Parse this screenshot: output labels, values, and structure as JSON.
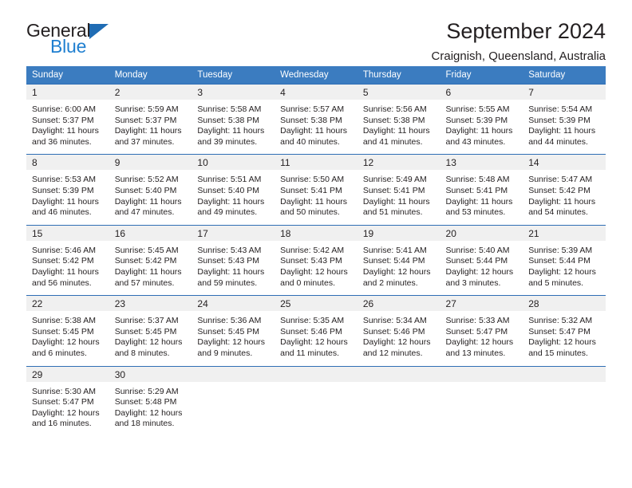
{
  "brand": {
    "name_top": "General",
    "name_bottom": "Blue",
    "accent_color": "#1f7fd0",
    "triangle_color": "#1f6cb4"
  },
  "header": {
    "title": "September 2024",
    "subtitle": "Craignish, Queensland, Australia"
  },
  "calendar": {
    "header_bg": "#3b7cc0",
    "header_text_color": "#ffffff",
    "daynum_bg": "#f0f0f0",
    "row_border_color": "#2f6eb5",
    "weekday_headers": [
      "Sunday",
      "Monday",
      "Tuesday",
      "Wednesday",
      "Thursday",
      "Friday",
      "Saturday"
    ],
    "weeks": [
      [
        {
          "day": "1",
          "sunrise": "Sunrise: 6:00 AM",
          "sunset": "Sunset: 5:37 PM",
          "daylight_1": "Daylight: 11 hours",
          "daylight_2": "and 36 minutes."
        },
        {
          "day": "2",
          "sunrise": "Sunrise: 5:59 AM",
          "sunset": "Sunset: 5:37 PM",
          "daylight_1": "Daylight: 11 hours",
          "daylight_2": "and 37 minutes."
        },
        {
          "day": "3",
          "sunrise": "Sunrise: 5:58 AM",
          "sunset": "Sunset: 5:38 PM",
          "daylight_1": "Daylight: 11 hours",
          "daylight_2": "and 39 minutes."
        },
        {
          "day": "4",
          "sunrise": "Sunrise: 5:57 AM",
          "sunset": "Sunset: 5:38 PM",
          "daylight_1": "Daylight: 11 hours",
          "daylight_2": "and 40 minutes."
        },
        {
          "day": "5",
          "sunrise": "Sunrise: 5:56 AM",
          "sunset": "Sunset: 5:38 PM",
          "daylight_1": "Daylight: 11 hours",
          "daylight_2": "and 41 minutes."
        },
        {
          "day": "6",
          "sunrise": "Sunrise: 5:55 AM",
          "sunset": "Sunset: 5:39 PM",
          "daylight_1": "Daylight: 11 hours",
          "daylight_2": "and 43 minutes."
        },
        {
          "day": "7",
          "sunrise": "Sunrise: 5:54 AM",
          "sunset": "Sunset: 5:39 PM",
          "daylight_1": "Daylight: 11 hours",
          "daylight_2": "and 44 minutes."
        }
      ],
      [
        {
          "day": "8",
          "sunrise": "Sunrise: 5:53 AM",
          "sunset": "Sunset: 5:39 PM",
          "daylight_1": "Daylight: 11 hours",
          "daylight_2": "and 46 minutes."
        },
        {
          "day": "9",
          "sunrise": "Sunrise: 5:52 AM",
          "sunset": "Sunset: 5:40 PM",
          "daylight_1": "Daylight: 11 hours",
          "daylight_2": "and 47 minutes."
        },
        {
          "day": "10",
          "sunrise": "Sunrise: 5:51 AM",
          "sunset": "Sunset: 5:40 PM",
          "daylight_1": "Daylight: 11 hours",
          "daylight_2": "and 49 minutes."
        },
        {
          "day": "11",
          "sunrise": "Sunrise: 5:50 AM",
          "sunset": "Sunset: 5:41 PM",
          "daylight_1": "Daylight: 11 hours",
          "daylight_2": "and 50 minutes."
        },
        {
          "day": "12",
          "sunrise": "Sunrise: 5:49 AM",
          "sunset": "Sunset: 5:41 PM",
          "daylight_1": "Daylight: 11 hours",
          "daylight_2": "and 51 minutes."
        },
        {
          "day": "13",
          "sunrise": "Sunrise: 5:48 AM",
          "sunset": "Sunset: 5:41 PM",
          "daylight_1": "Daylight: 11 hours",
          "daylight_2": "and 53 minutes."
        },
        {
          "day": "14",
          "sunrise": "Sunrise: 5:47 AM",
          "sunset": "Sunset: 5:42 PM",
          "daylight_1": "Daylight: 11 hours",
          "daylight_2": "and 54 minutes."
        }
      ],
      [
        {
          "day": "15",
          "sunrise": "Sunrise: 5:46 AM",
          "sunset": "Sunset: 5:42 PM",
          "daylight_1": "Daylight: 11 hours",
          "daylight_2": "and 56 minutes."
        },
        {
          "day": "16",
          "sunrise": "Sunrise: 5:45 AM",
          "sunset": "Sunset: 5:42 PM",
          "daylight_1": "Daylight: 11 hours",
          "daylight_2": "and 57 minutes."
        },
        {
          "day": "17",
          "sunrise": "Sunrise: 5:43 AM",
          "sunset": "Sunset: 5:43 PM",
          "daylight_1": "Daylight: 11 hours",
          "daylight_2": "and 59 minutes."
        },
        {
          "day": "18",
          "sunrise": "Sunrise: 5:42 AM",
          "sunset": "Sunset: 5:43 PM",
          "daylight_1": "Daylight: 12 hours",
          "daylight_2": "and 0 minutes."
        },
        {
          "day": "19",
          "sunrise": "Sunrise: 5:41 AM",
          "sunset": "Sunset: 5:44 PM",
          "daylight_1": "Daylight: 12 hours",
          "daylight_2": "and 2 minutes."
        },
        {
          "day": "20",
          "sunrise": "Sunrise: 5:40 AM",
          "sunset": "Sunset: 5:44 PM",
          "daylight_1": "Daylight: 12 hours",
          "daylight_2": "and 3 minutes."
        },
        {
          "day": "21",
          "sunrise": "Sunrise: 5:39 AM",
          "sunset": "Sunset: 5:44 PM",
          "daylight_1": "Daylight: 12 hours",
          "daylight_2": "and 5 minutes."
        }
      ],
      [
        {
          "day": "22",
          "sunrise": "Sunrise: 5:38 AM",
          "sunset": "Sunset: 5:45 PM",
          "daylight_1": "Daylight: 12 hours",
          "daylight_2": "and 6 minutes."
        },
        {
          "day": "23",
          "sunrise": "Sunrise: 5:37 AM",
          "sunset": "Sunset: 5:45 PM",
          "daylight_1": "Daylight: 12 hours",
          "daylight_2": "and 8 minutes."
        },
        {
          "day": "24",
          "sunrise": "Sunrise: 5:36 AM",
          "sunset": "Sunset: 5:45 PM",
          "daylight_1": "Daylight: 12 hours",
          "daylight_2": "and 9 minutes."
        },
        {
          "day": "25",
          "sunrise": "Sunrise: 5:35 AM",
          "sunset": "Sunset: 5:46 PM",
          "daylight_1": "Daylight: 12 hours",
          "daylight_2": "and 11 minutes."
        },
        {
          "day": "26",
          "sunrise": "Sunrise: 5:34 AM",
          "sunset": "Sunset: 5:46 PM",
          "daylight_1": "Daylight: 12 hours",
          "daylight_2": "and 12 minutes."
        },
        {
          "day": "27",
          "sunrise": "Sunrise: 5:33 AM",
          "sunset": "Sunset: 5:47 PM",
          "daylight_1": "Daylight: 12 hours",
          "daylight_2": "and 13 minutes."
        },
        {
          "day": "28",
          "sunrise": "Sunrise: 5:32 AM",
          "sunset": "Sunset: 5:47 PM",
          "daylight_1": "Daylight: 12 hours",
          "daylight_2": "and 15 minutes."
        }
      ],
      [
        {
          "day": "29",
          "sunrise": "Sunrise: 5:30 AM",
          "sunset": "Sunset: 5:47 PM",
          "daylight_1": "Daylight: 12 hours",
          "daylight_2": "and 16 minutes."
        },
        {
          "day": "30",
          "sunrise": "Sunrise: 5:29 AM",
          "sunset": "Sunset: 5:48 PM",
          "daylight_1": "Daylight: 12 hours",
          "daylight_2": "and 18 minutes."
        },
        {
          "day": "",
          "sunrise": "",
          "sunset": "",
          "daylight_1": "",
          "daylight_2": ""
        },
        {
          "day": "",
          "sunrise": "",
          "sunset": "",
          "daylight_1": "",
          "daylight_2": ""
        },
        {
          "day": "",
          "sunrise": "",
          "sunset": "",
          "daylight_1": "",
          "daylight_2": ""
        },
        {
          "day": "",
          "sunrise": "",
          "sunset": "",
          "daylight_1": "",
          "daylight_2": ""
        },
        {
          "day": "",
          "sunrise": "",
          "sunset": "",
          "daylight_1": "",
          "daylight_2": ""
        }
      ]
    ]
  }
}
